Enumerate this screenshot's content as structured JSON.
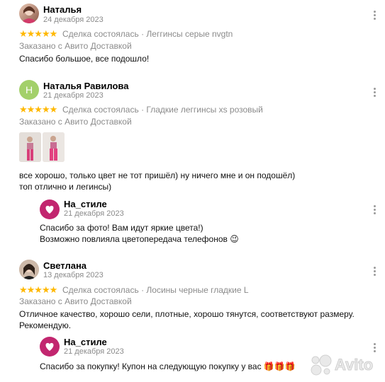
{
  "reviews": [
    {
      "author": "Наталья",
      "date": "24 декабря 2023",
      "stars": "★★★★★",
      "deal_line": "Сделка состоялась · Леггинсы серые nvgtn",
      "delivery": "Заказано с Авито Доставкой",
      "text": "Спасибо большое, все подошло!"
    },
    {
      "author": "Наталья Равилова",
      "avatar_letter": "Н",
      "date": "21 декабря 2023",
      "stars": "★★★★★",
      "deal_line": "Сделка состоялась · Гладкие леггинсы xs розовый",
      "delivery": "Заказано с Авито Доставкой",
      "text_line1": "все хорошо, только цвет не тот пришёл) ну ничего мне и он подошёл)",
      "text_line2": "топ отлично и легинсы)",
      "reply": {
        "author": "На_стиле",
        "date": "21 декабря 2023",
        "line1": "Спасибо за фото! Вам идут яркие цвета!)",
        "line2": "Возможно повлияла цветопередача телефонов 😉"
      }
    },
    {
      "author": "Светлана",
      "date": "13 декабря 2023",
      "stars": "★★★★★",
      "deal_line": "Сделка состоялась · Лосины черные гладкие L",
      "delivery": "Заказано с Авито Доставкой",
      "text_line1": "Отличное качество, хорошо сели, плотные, хорошо тянутся, соответствуют размеру.",
      "text_line2": "Рекомендую.",
      "reply": {
        "author": "На_стиле",
        "date": "21 декабря 2023",
        "line1": "Спасибо за покупку! Купон на следующую покупку у вас 🎁🎁🎁"
      }
    }
  ],
  "watermark": "Avito",
  "colors": {
    "star": "#ffb800",
    "green_avatar": "#a3d06a",
    "shop_avatar": "#c2266f",
    "meta_gray": "#8b8b8b"
  }
}
